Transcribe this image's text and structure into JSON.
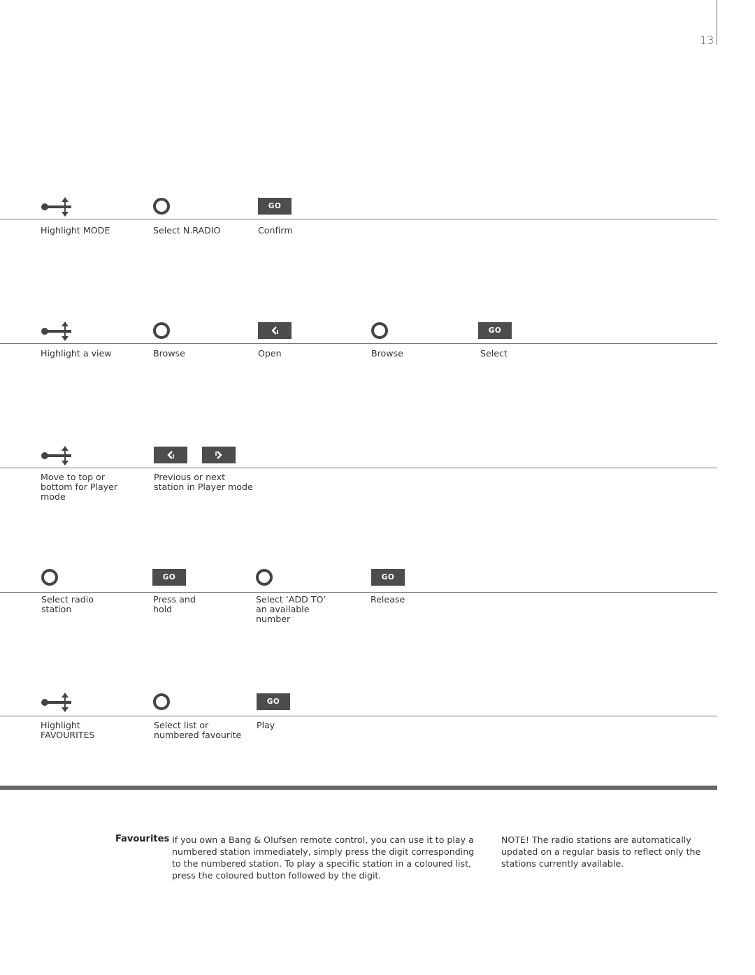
{
  "page": {
    "number": "13"
  },
  "rows": [
    {
      "steps": [
        {
          "icon": "wheel-navigation-icon",
          "label": "Highlight MODE"
        },
        {
          "icon": "circle-wheel-icon",
          "label": "Select N.RADIO"
        },
        {
          "icon": "go-button",
          "button_text": "GO",
          "label": "Confirm"
        }
      ]
    },
    {
      "steps": [
        {
          "icon": "wheel-navigation-icon",
          "label": "Highlight a view"
        },
        {
          "icon": "circle-wheel-icon",
          "label": "Browse"
        },
        {
          "icon": "back-arrow-button",
          "label": "Open"
        },
        {
          "icon": "circle-wheel-icon",
          "label": "Browse"
        },
        {
          "icon": "go-button",
          "button_text": "GO",
          "label": "Select"
        }
      ]
    },
    {
      "steps": [
        {
          "icon": "wheel-navigation-icon",
          "label": "Move to top or\nbottom for Player\nmode"
        },
        {
          "icon": "prev-next-buttons",
          "label": "Previous or next\nstation in Player mode"
        }
      ]
    },
    {
      "steps": [
        {
          "icon": "circle-wheel-icon",
          "label": "Select radio\nstation"
        },
        {
          "icon": "go-button",
          "button_text": "GO",
          "label": "Press and\nhold"
        },
        {
          "icon": "circle-wheel-icon",
          "label": "Select ‘ADD TO’\nan available\nnumber"
        },
        {
          "icon": "go-button",
          "button_text": "GO",
          "label": "Release"
        }
      ]
    },
    {
      "steps": [
        {
          "icon": "wheel-navigation-icon",
          "label": "Highlight\nFAVOURITES"
        },
        {
          "icon": "circle-wheel-icon",
          "label": "Select list or\nnumbered favourite"
        },
        {
          "icon": "go-button",
          "button_text": "GO",
          "label": "Play"
        }
      ]
    }
  ],
  "favourites": {
    "heading": "Favourites",
    "text": "If you own a Bang & Olufsen remote control, you can use it to play a numbered station immediately, simply press the digit corresponding to the numbered station. To play a specific station in a coloured list, press the coloured button followed by the digit."
  },
  "note": {
    "text": "NOTE! The radio stations are automatically updated on a regular basis to reflect only the stations currently available."
  },
  "colors": {
    "key_fill": "#4d4d4d",
    "rule": "#777777",
    "thick_rule": "#656565"
  }
}
